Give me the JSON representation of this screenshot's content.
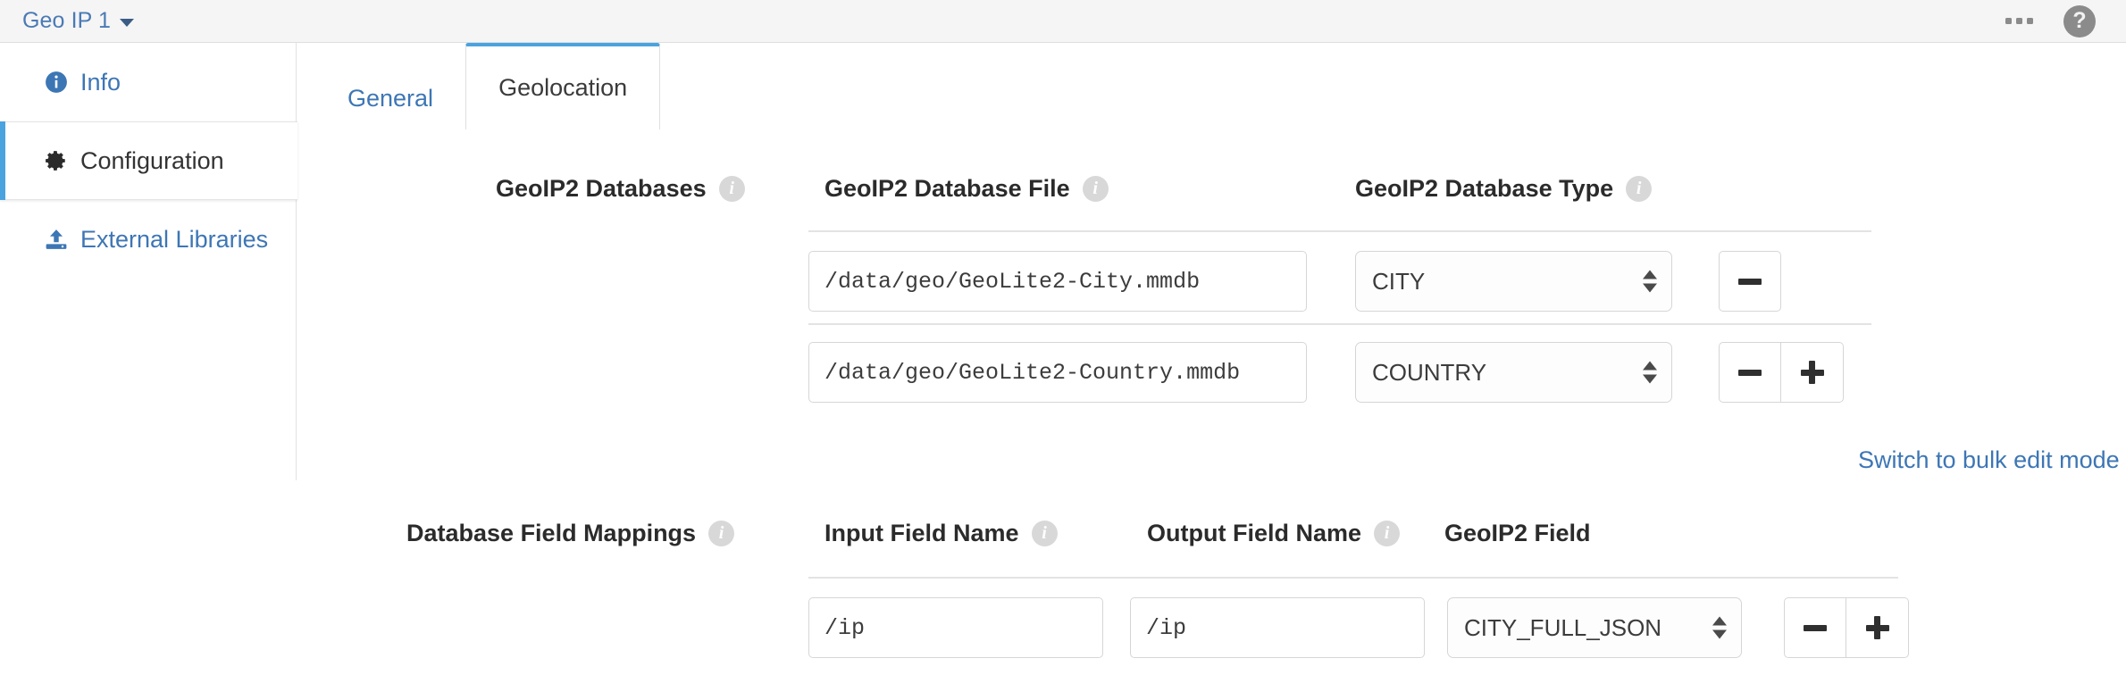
{
  "header": {
    "breadcrumb_label": "Geo IP 1",
    "caret_icon": "chevron-down-icon",
    "overflow_icon": "ellipsis-icon",
    "help_label": "?"
  },
  "sidebar": {
    "items": [
      {
        "label": "Info",
        "icon": "info-circle-icon",
        "active": false
      },
      {
        "label": "Configuration",
        "icon": "gear-icon",
        "active": true
      },
      {
        "label": "External Libraries",
        "icon": "upload-icon",
        "active": false
      }
    ]
  },
  "tabs": [
    {
      "label": "General",
      "active": false
    },
    {
      "label": "Geolocation",
      "active": true
    }
  ],
  "databases_section": {
    "group_label": "GeoIP2 Databases",
    "columns": [
      {
        "label": "GeoIP2 Database File",
        "info": true
      },
      {
        "label": "GeoIP2 Database Type",
        "info": true
      }
    ],
    "rows": [
      {
        "file": "/data/geo/GeoLite2-City.mmdb",
        "type": "CITY",
        "has_remove": true,
        "has_add": false
      },
      {
        "file": "/data/geo/GeoLite2-Country.mmdb",
        "type": "COUNTRY",
        "has_remove": true,
        "has_add": true
      }
    ],
    "bulk_edit_link": "Switch to bulk edit mode"
  },
  "mappings_section": {
    "group_label": "Database Field Mappings",
    "columns": [
      {
        "label": "Input Field Name",
        "info": true
      },
      {
        "label": "Output Field Name",
        "info": true
      },
      {
        "label": "GeoIP2 Field",
        "info": false
      }
    ],
    "rows": [
      {
        "input_field": "/ip",
        "output_field": "/ip",
        "geoip2_field": "CITY_FULL_JSON",
        "has_remove": true,
        "has_add": true
      }
    ]
  },
  "glyphs": {
    "minus": "minus-icon",
    "plus": "plus-icon",
    "info": "i"
  },
  "colors": {
    "link": "#3d76b5",
    "accent": "#4aa3df",
    "header_bg": "#f5f5f5",
    "border": "#e0e0e0",
    "text": "#2b2b2b"
  }
}
